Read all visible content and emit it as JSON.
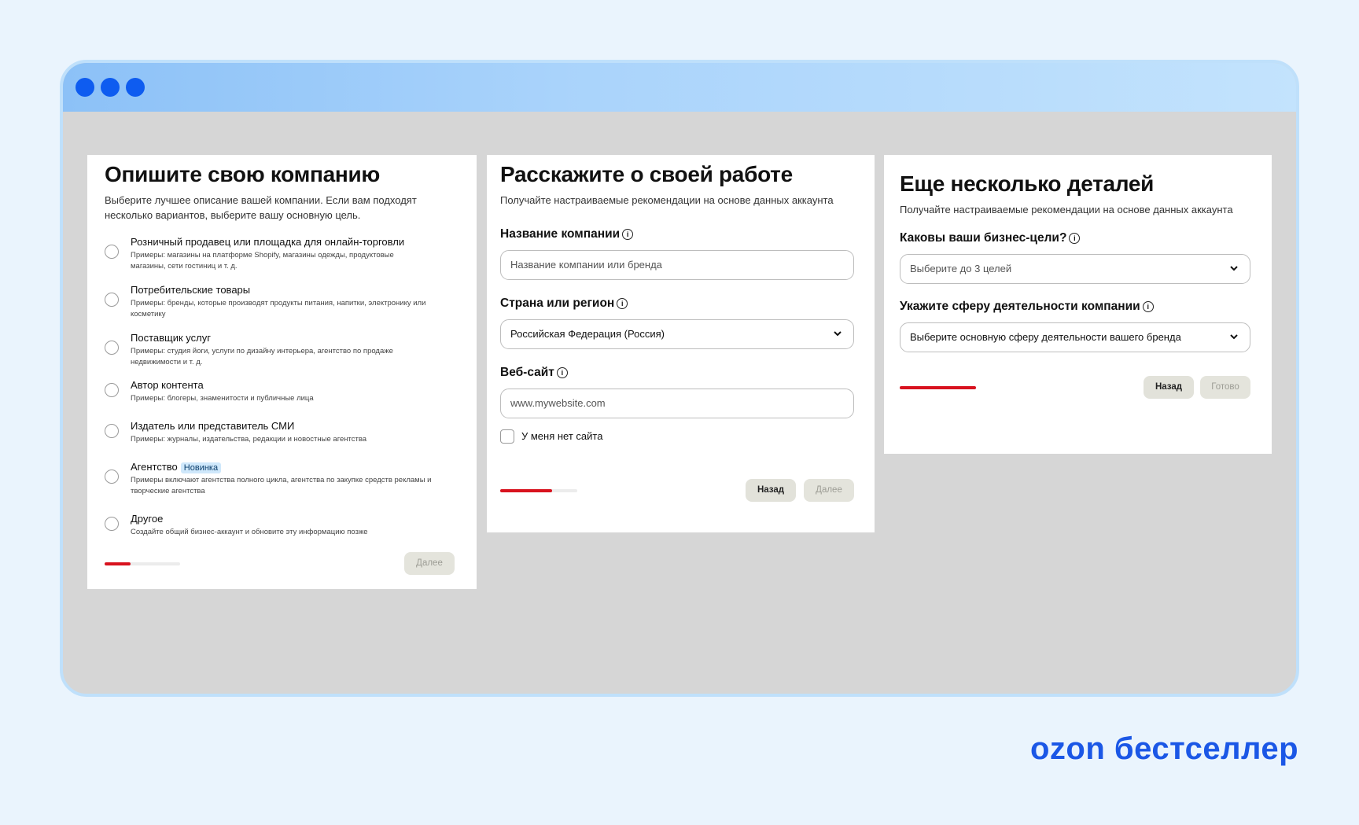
{
  "window": {
    "dots": [
      "",
      "",
      ""
    ]
  },
  "card1": {
    "title": "Опишите свою компанию",
    "subtitle": "Выберите лучшее описание вашей компании. Если вам подходят несколько вариантов, выберите вашу основную цель.",
    "options": [
      {
        "title": "Розничный продавец или площадка для онлайн-торговли",
        "desc": "Примеры: магазины на платформе Shopify, магазины одежды, продуктовые магазины, сети гостиниц и т. д."
      },
      {
        "title": "Потребительские товары",
        "desc": "Примеры: бренды, которые производят продукты питания, напитки, электронику или косметику"
      },
      {
        "title": "Поставщик услуг",
        "desc": "Примеры: студия йоги, услуги по дизайну интерьера, агентство по продаже недвижимости и т. д."
      },
      {
        "title": "Автор контента",
        "desc": "Примеры: блогеры, знаменитости и публичные лица"
      },
      {
        "title": "Издатель или представитель СМИ",
        "desc": "Примеры: журналы, издательства, редакции и новостные агентства"
      },
      {
        "title": "Агентство",
        "badge": "Новинка",
        "desc": "Примеры включают агентства полного цикла, агентства по закупке средств рекламы и творческие агентства"
      },
      {
        "title": "Другое",
        "desc": "Создайте общий бизнес-аккаунт и обновите эту информацию позже"
      }
    ],
    "progress": 0.34,
    "next_label": "Далее"
  },
  "card2": {
    "title": "Расскажите о своей работе",
    "subtitle": "Получайте настраиваемые рекомендации на основе данных аккаунта",
    "company_label": "Название компании",
    "company_placeholder": "Название компании или бренда",
    "country_label": "Страна или регион",
    "country_value": "Российская Федерация (Россия)",
    "website_label": "Веб-сайт",
    "website_placeholder": "www.mywebsite.com",
    "no_site_label": "У меня нет сайта",
    "progress": 0.67,
    "back_label": "Назад",
    "next_label": "Далее"
  },
  "card3": {
    "title": "Еще несколько деталей",
    "subtitle": "Получайте настраиваемые рекомендации на основе данных аккаунта",
    "goals_label": "Каковы ваши бизнес-цели?",
    "goals_placeholder": "Выберите до 3 целей",
    "industry_label": "Укажите сферу деятельности компании",
    "industry_placeholder": "Выберите основную сферу деятельности вашего бренда",
    "progress": 1.0,
    "back_label": "Назад",
    "done_label": "Готово"
  },
  "icons": {
    "info": "i"
  },
  "brand": {
    "logo": "ozon бестселлер",
    "accent": "#d8121e",
    "logo_color": "#1b57e6"
  }
}
